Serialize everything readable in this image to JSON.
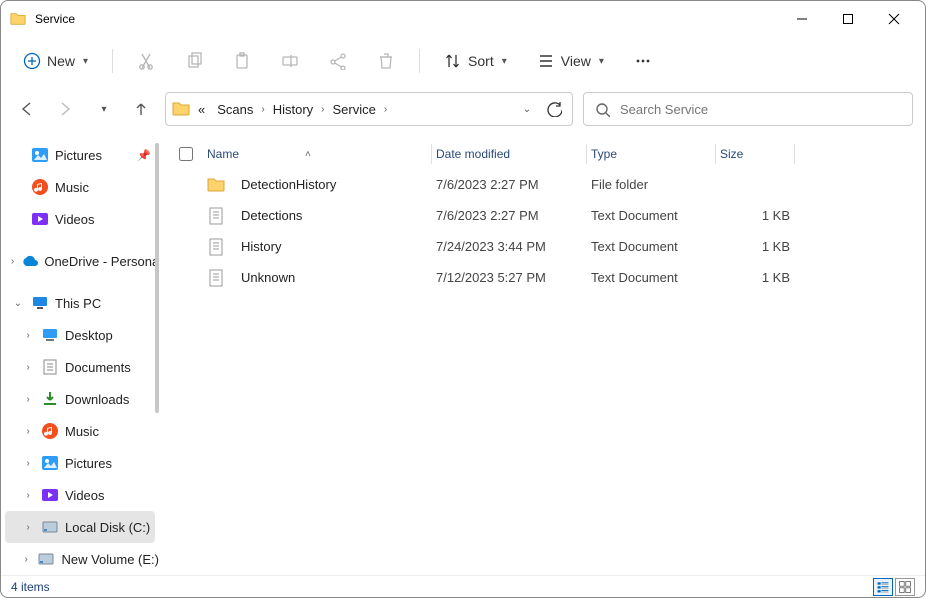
{
  "window": {
    "title": "Service"
  },
  "toolbar": {
    "new_label": "New",
    "sort_label": "Sort",
    "view_label": "View"
  },
  "breadcrumb": {
    "prefix": "«",
    "crumbs": [
      "Scans",
      "History",
      "Service"
    ]
  },
  "search": {
    "placeholder": "Search Service"
  },
  "columns": {
    "name": "Name",
    "date": "Date modified",
    "type": "Type",
    "size": "Size"
  },
  "files": [
    {
      "icon": "folder",
      "name": "DetectionHistory",
      "date": "7/6/2023 2:27 PM",
      "type": "File folder",
      "size": ""
    },
    {
      "icon": "text",
      "name": "Detections",
      "date": "7/6/2023 2:27 PM",
      "type": "Text Document",
      "size": "1 KB"
    },
    {
      "icon": "text",
      "name": "History",
      "date": "7/24/2023 3:44 PM",
      "type": "Text Document",
      "size": "1 KB"
    },
    {
      "icon": "text",
      "name": "Unknown",
      "date": "7/12/2023 5:27 PM",
      "type": "Text Document",
      "size": "1 KB"
    }
  ],
  "sidebar_quick": [
    {
      "icon": "pictures",
      "label": "Pictures",
      "pinned": true
    },
    {
      "icon": "music",
      "label": "Music"
    },
    {
      "icon": "videos",
      "label": "Videos"
    }
  ],
  "sidebar_groups": [
    {
      "chev": "right",
      "icon": "onedrive",
      "label": "OneDrive - Personal"
    }
  ],
  "sidebar_thispc": {
    "chev": "down",
    "icon": "pc",
    "label": "This PC",
    "children": [
      {
        "icon": "desktop",
        "label": "Desktop"
      },
      {
        "icon": "documents",
        "label": "Documents"
      },
      {
        "icon": "downloads",
        "label": "Downloads"
      },
      {
        "icon": "music",
        "label": "Music"
      },
      {
        "icon": "pictures",
        "label": "Pictures"
      },
      {
        "icon": "videos",
        "label": "Videos"
      },
      {
        "icon": "disk",
        "label": "Local Disk (C:)",
        "selected": true
      },
      {
        "icon": "disk",
        "label": "New Volume (E:)"
      }
    ]
  },
  "status": {
    "count": "4 items"
  }
}
